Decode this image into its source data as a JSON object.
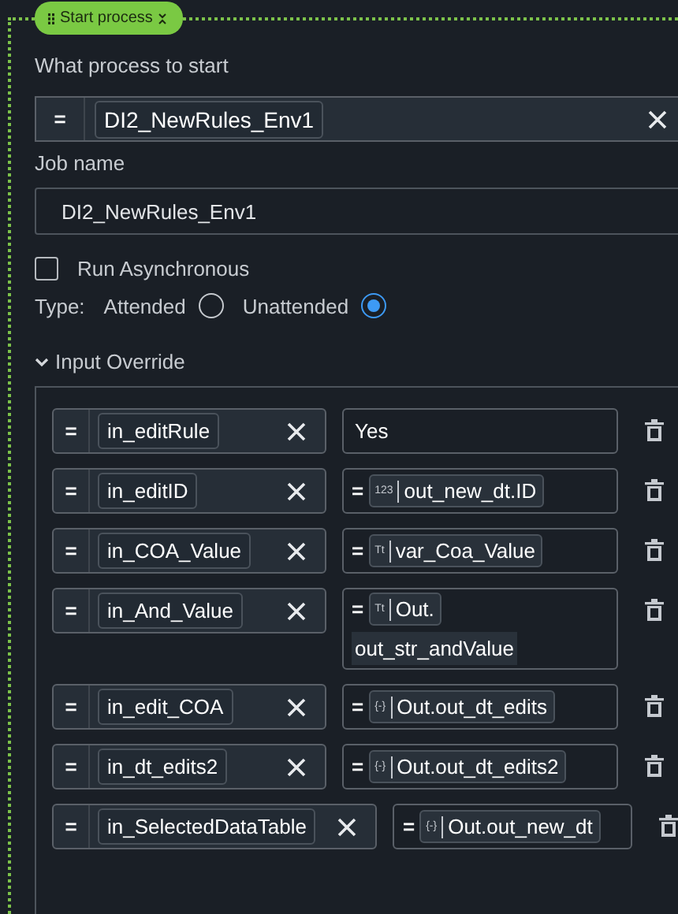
{
  "activity": {
    "title": "Start process"
  },
  "process": {
    "label": "What process to start",
    "toggle": "=",
    "value": "DI2_NewRules_Env1"
  },
  "job_name": {
    "label": "Job name",
    "value": "DI2_NewRules_Env1"
  },
  "run_async": {
    "label": "Run Asynchronous",
    "checked": false
  },
  "type": {
    "label": "Type:",
    "options": [
      {
        "label": "Attended",
        "selected": false
      },
      {
        "label": "Unattended",
        "selected": true
      }
    ]
  },
  "input_override": {
    "label": "Input Override",
    "expanded": true,
    "rows": [
      {
        "toggle": "=",
        "name": "in_editRule",
        "value": {
          "kind": "literal",
          "text": "Yes"
        }
      },
      {
        "toggle": "=",
        "name": "in_editID",
        "value": {
          "kind": "expression",
          "sign": "=",
          "type_label": "123",
          "text": "out_new_dt.ID"
        }
      },
      {
        "toggle": "=",
        "name": "in_COA_Value",
        "value": {
          "kind": "expression",
          "sign": "=",
          "type_label": "Tt",
          "text": "var_Coa_Value"
        }
      },
      {
        "toggle": "=",
        "name": "in_And_Value",
        "value": {
          "kind": "expression",
          "sign": "=",
          "type_label": "Tt",
          "text": "Out.",
          "text_continued": "out_str_andValue"
        }
      },
      {
        "toggle": "=",
        "name": "in_edit_COA",
        "value": {
          "kind": "expression",
          "sign": "=",
          "type_label": "{-}",
          "text": "Out.out_dt_edits"
        }
      },
      {
        "toggle": "=",
        "name": "in_dt_edits2",
        "value": {
          "kind": "expression",
          "sign": "=",
          "type_label": "{-}",
          "text": "Out.out_dt_edits2"
        }
      },
      {
        "toggle": "=",
        "name": "in_SelectedDataTable",
        "value": {
          "kind": "expression",
          "sign": "=",
          "type_label": "{-}",
          "text": "Out.out_new_dt"
        }
      }
    ]
  }
}
